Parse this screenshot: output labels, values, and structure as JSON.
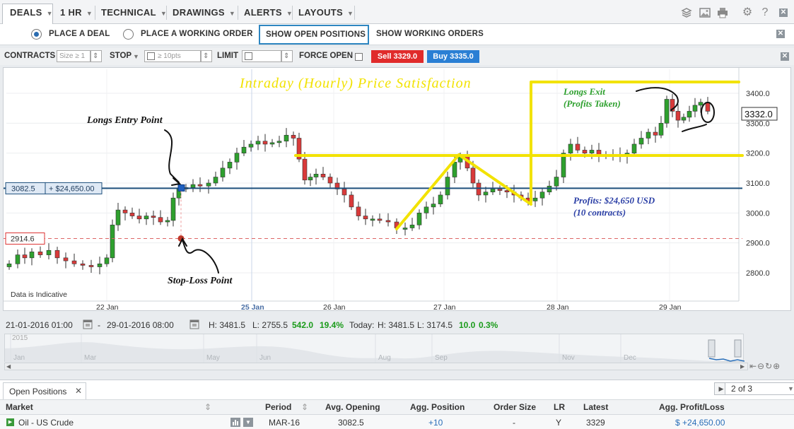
{
  "menu": {
    "items": [
      {
        "label": "DEALS",
        "x": 0
      },
      {
        "label": "1 HR"
      },
      {
        "label": "TECHNICAL"
      },
      {
        "label": "DRAWINGS"
      },
      {
        "label": "ALERTS"
      },
      {
        "label": "LAYOUTS"
      }
    ]
  },
  "deal_bar": {
    "place_deal": "PLACE A DEAL",
    "place_working": "PLACE A WORKING ORDER",
    "show_open": "SHOW OPEN POSITIONS",
    "show_working": "SHOW WORKING ORDERS"
  },
  "ticket": {
    "contracts_label": "CONTRACTS",
    "size_placeholder": "Size ≥ 1",
    "stop_label": "STOP",
    "stop_placeholder": "≥ 10pts",
    "limit_label": "LIMIT",
    "force_open_label": "FORCE OPEN",
    "sell_label": "Sell 3329.0",
    "buy_label": "Buy 3335.0"
  },
  "chart_data": {
    "type": "candlestick",
    "title": "Intraday (Hourly) Price Satisfaction",
    "y_ticks": [
      "3400.0",
      "3300.0",
      "3200.0",
      "3100.0",
      "3000.0",
      "2900.0",
      "2800.0"
    ],
    "x_ticks": [
      "22 Jan",
      "25 Jan",
      "26 Jan",
      "27 Jan",
      "28 Jan",
      "29 Jan"
    ],
    "ylim": [
      2760,
      3480
    ],
    "current_price": "3332.0",
    "position_level": 3082.5,
    "position_level_label": "3082.5",
    "position_pnl_label": "+ $24,650.00",
    "stop_level": 2914.6,
    "stop_level_label": "2914.6",
    "data_note": "Data is Indicative",
    "annotations": {
      "longs_entry": "Longs Entry Point",
      "stop_loss": "Stop-Loss Point",
      "longs_exit_1": "Longs Exit",
      "longs_exit_2": "(Profits Taken)",
      "profits_1": "Profits: $24,650 USD",
      "profits_2": "(10 contracts)"
    },
    "colors": {
      "up": "#2ea02e",
      "down": "#d93a3a",
      "annotation": "#f2e200",
      "position_line": "#1d4f7c"
    }
  },
  "info_bar": {
    "from": "21-01-2016 01:00",
    "to": "29-01-2016 08:00",
    "high": "H: 3481.5",
    "low": "L: 2755.5",
    "change": "542.0",
    "change_pct": "19.4%",
    "today_label": "Today:",
    "today_high": "H: 3481.5",
    "today_low": "L: 3174.5",
    "today_change": "10.0",
    "today_pct": "0.3%"
  },
  "navigator": {
    "year": "2015",
    "months": [
      "Jan",
      "Mar",
      "May",
      "Jun",
      "Aug",
      "Sep",
      "Nov",
      "Dec"
    ]
  },
  "positions": {
    "tab_label": "Open Positions",
    "pager": "2 of 3",
    "headers": [
      "Market",
      "Period",
      "Avg. Opening",
      "Agg. Position",
      "Order Size",
      "LR",
      "Latest",
      "Agg. Profit/Loss"
    ],
    "row": {
      "market": "Oil - US Crude",
      "period": "MAR-16",
      "avg_opening": "3082.5",
      "agg_position": "+10",
      "order_size": "-",
      "lr": "Y",
      "latest": "3329",
      "pnl": "$ +24,650.00"
    }
  }
}
